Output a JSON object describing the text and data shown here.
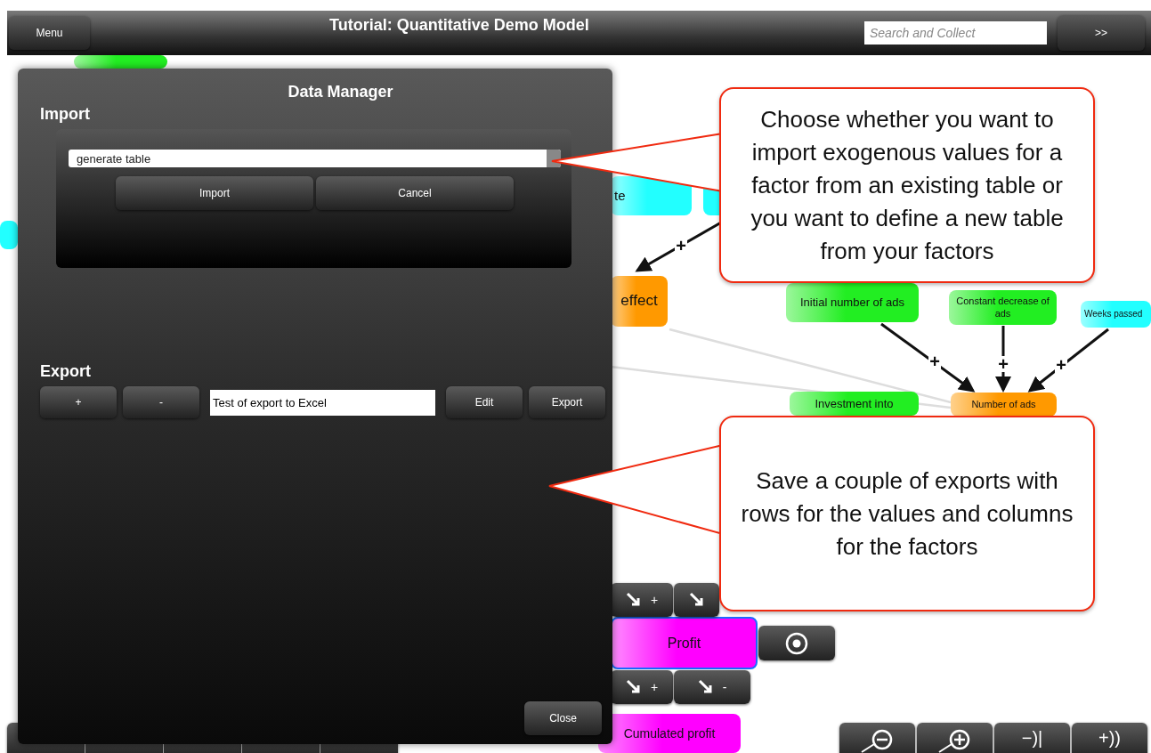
{
  "toolbar": {
    "menu_button": "Menu",
    "title": "Tutorial: Quantitative Demo Model",
    "search": {
      "placeholder": "Search and Collect"
    },
    "forward_button": ">>"
  },
  "diagram": {
    "nodes": [
      {
        "color": "#22ee22",
        "selected": false
      },
      {
        "color": "#22ffff",
        "selected": false
      },
      {
        "label": "te",
        "color": "#22ffff",
        "selected": false
      },
      {
        "color": "#22ffff",
        "selected": false
      },
      {
        "label": "effect",
        "color": "#ff9900",
        "selected": false
      },
      {
        "label": "Initial number of ads",
        "color": "#22ee22",
        "selected": false
      },
      {
        "label": "Constant decrease of ads",
        "color": "#22ee22",
        "selected": false
      },
      {
        "label": "Weeks passed",
        "color": "#22ffff",
        "selected": false
      },
      {
        "label": "Investment into",
        "color": "#22ee22",
        "selected": false
      },
      {
        "label": "Number of ads",
        "color": "#ff9900",
        "selected": false
      },
      {
        "label": "Profit",
        "color": "#ff00ff",
        "selected": true
      },
      {
        "label": "Cumulated profit",
        "color": "#ff00ff",
        "selected": false
      }
    ],
    "edges": [
      {
        "kind": "arrow",
        "sign": "+"
      },
      {
        "kind": "arrow",
        "sign": "+"
      },
      {
        "kind": "arrow",
        "sign": "+"
      },
      {
        "kind": "arrow",
        "sign": "+"
      },
      {
        "kind": "line"
      },
      {
        "kind": "line"
      }
    ],
    "node_tools": {
      "above": [
        {
          "kind": "signed",
          "sign": "+"
        },
        {
          "kind": "plain"
        }
      ],
      "below": [
        {
          "kind": "signed",
          "sign": "+"
        },
        {
          "kind": "signed",
          "sign": "-"
        }
      ]
    }
  },
  "view_buttons": [
    {
      "kind": "zoom-out"
    },
    {
      "kind": "zoom-in"
    },
    {
      "kind": "text",
      "label": "−)|"
    },
    {
      "kind": "text",
      "label": "+))"
    }
  ],
  "dialog": {
    "title": "Data Manager",
    "import": {
      "heading": "Import",
      "source": {
        "value": "generate table"
      },
      "buttons": [
        "Import",
        "Cancel"
      ]
    },
    "export": {
      "heading": "Export",
      "add_button": "+",
      "remove_button": "-",
      "name_field": {
        "value": "Test of export to Excel"
      },
      "buttons": [
        "Edit",
        "Export"
      ]
    },
    "close_button": "Close"
  },
  "callouts": [
    {
      "text": "Choose whether you want to import exogenous values for a factor from an existing table or you want to define a new table from your factors"
    },
    {
      "text": "Save a couple of exports with rows for the values and columns for the factors"
    }
  ]
}
